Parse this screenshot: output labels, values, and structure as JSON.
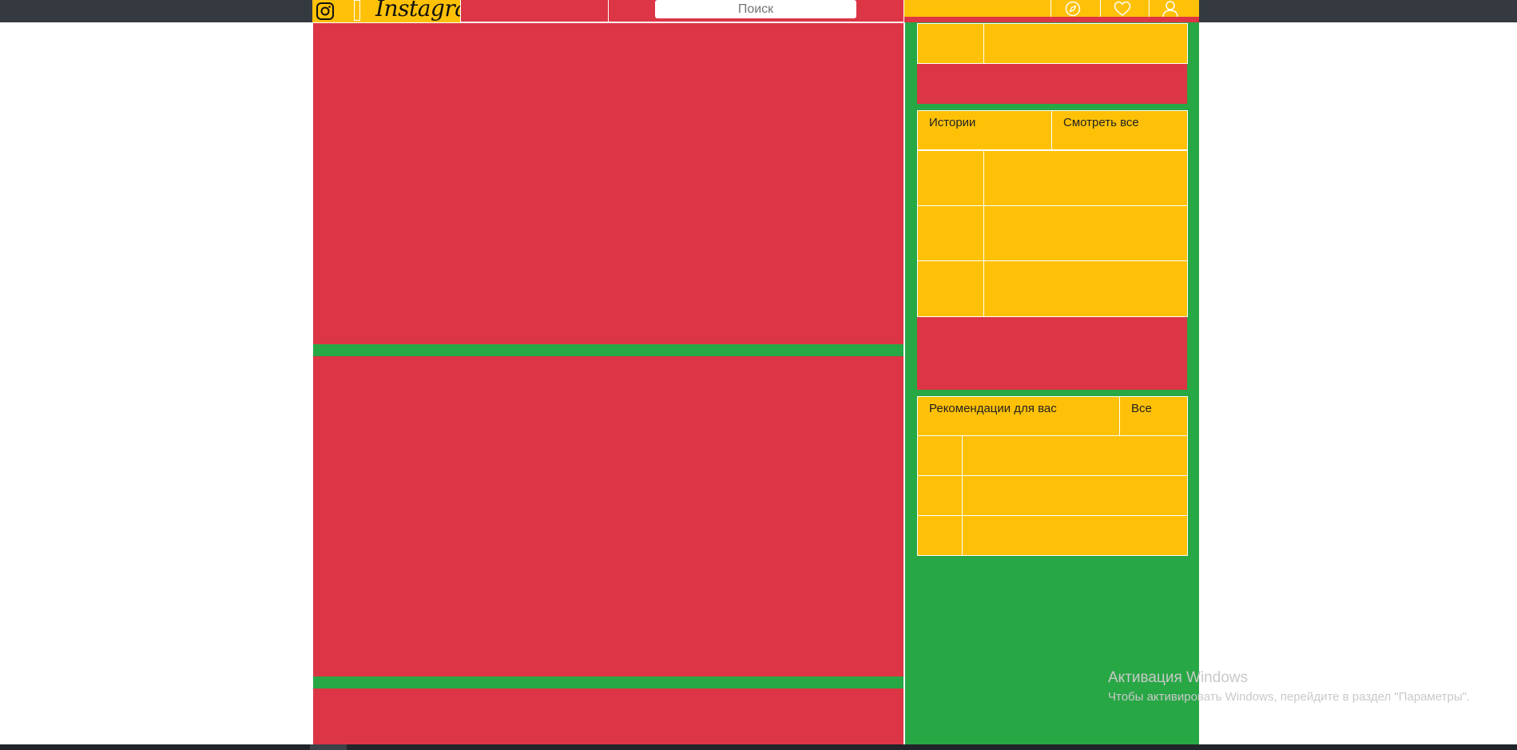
{
  "header": {
    "logo_text": "Instagram",
    "search_placeholder": "Поиск",
    "icons": [
      "instagram-icon",
      "compass-icon",
      "heart-icon",
      "user-icon"
    ]
  },
  "sidebar": {
    "stories": {
      "title": "Истории",
      "see_all": "Смотреть все"
    },
    "recommendations": {
      "title": "Рекомендации для вас",
      "see_all": "Все"
    }
  },
  "watermark": {
    "title": "Активация Windows",
    "subtitle": "Чтобы активировать Windows, перейдите в раздел \"Параметры\"."
  },
  "colors": {
    "red": "#dc3545",
    "yellow": "#ffc107",
    "green": "#28a745",
    "dark": "#343a40"
  }
}
